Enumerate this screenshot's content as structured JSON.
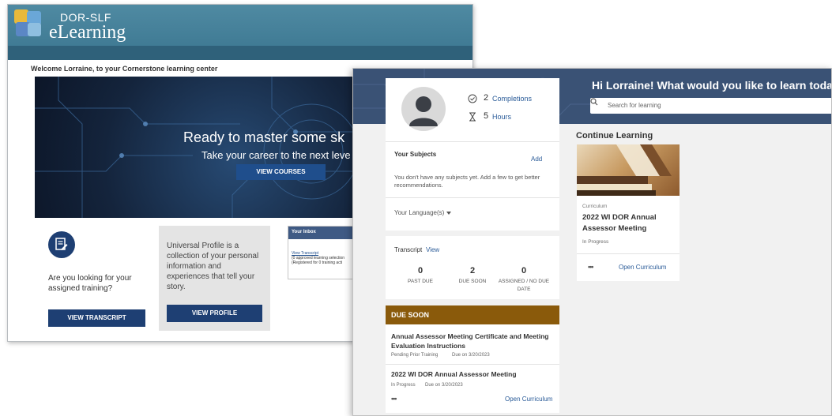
{
  "back_window": {
    "brand_top": "DOR-SLF",
    "brand_bottom": "eLearning",
    "welcome": "Welcome Lorraine, to your Cornerstone learning center",
    "hero": {
      "title": "Ready to master some sk",
      "subtitle": "Take your career to the next leve",
      "button": "VIEW COURSES"
    },
    "assigned_tile": {
      "text": "Are you looking for your assigned training?",
      "button": "VIEW TRANSCRIPT"
    },
    "profile_tile": {
      "text": "Universal Profile is a collection of your personal information and experiences that tell your story.",
      "button": "VIEW PROFILE"
    },
    "inbox": {
      "title": "Your Inbox",
      "link": "View Transcript",
      "line1": "(0 approved learning selection",
      "line2": "(Registered for 0 training acti"
    }
  },
  "front_window": {
    "greeting": "Hi Lorraine! What would you like to learn today?",
    "search_placeholder": "Search for learning",
    "stats": {
      "completions_value": "2",
      "completions_label": "Completions",
      "hours_value": "5",
      "hours_label": "Hours"
    },
    "subjects": {
      "title": "Your Subjects",
      "add": "Add",
      "empty_text": "You don't have any subjects yet. Add a few to get better recommendations."
    },
    "language_label": "Your Language(s)",
    "transcript": {
      "title": "Transcript",
      "view": "View",
      "past_due_value": "0",
      "past_due_label": "PAST DUE",
      "due_soon_value": "2",
      "due_soon_label": "DUE SOON",
      "assigned_value": "0",
      "assigned_label_1": "ASSIGNED / NO DUE",
      "assigned_label_2": "DATE"
    },
    "due_soon": {
      "header": "DUE SOON",
      "item1": {
        "title": "Annual Assessor Meeting Certificate and Meeting Evaluation Instructions",
        "status": "Pending Prior Training",
        "due": "Due on 3/20/2023"
      },
      "item2": {
        "title": "2022 WI DOR Annual Assessor Meeting",
        "status": "In Progress",
        "due": "Due on 3/20/2023",
        "more": "•••",
        "action": "Open Curriculum"
      }
    },
    "continue_learning": {
      "title": "Continue Learning",
      "type": "Curriculum",
      "name": "2022 WI DOR Annual Assessor Meeting",
      "status": "In Progress",
      "more": "•••",
      "action": "Open Curriculum"
    },
    "colors": {
      "banner": "#3a5275",
      "due_header": "#8a5a0b",
      "link": "#2a5b98",
      "primary_button": "#1e3f73"
    }
  }
}
